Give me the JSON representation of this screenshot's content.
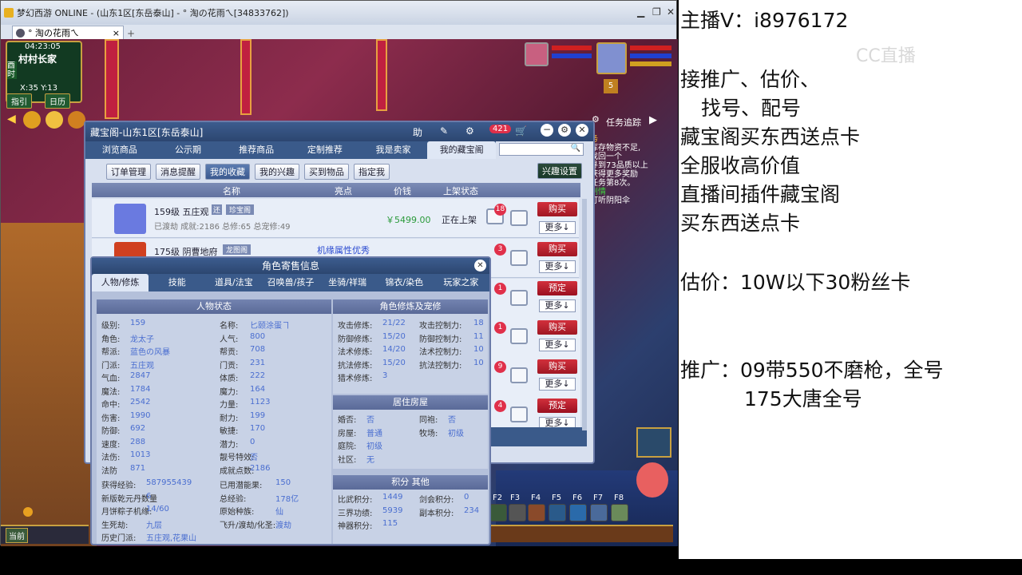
{
  "window": {
    "title": "梦幻西游 ONLINE - (山东1区[东岳泰山] - ° 淘の花雨ㄟ[34833762])",
    "tab_label": "° 淘の花雨ㄟ",
    "tab_close": "×",
    "tab_add": "+",
    "minimize": "▁",
    "restore": "❐",
    "close": "✕"
  },
  "hud": {
    "time": "04:23:05",
    "location": "村村长家",
    "day": "酉时",
    "coords": "X:35  Y:13",
    "guide": "指引",
    "calendar": "日历",
    "quest_tracker": "任务追踪",
    "chat_lines": [
      "务",
      "库存物资不足,",
      "找回一个",
      "寻到73品质以上",
      "获得更多奖励",
      "任务第8次。",
      "",
      "剧情",
      "打听阴阳伞"
    ],
    "level_badge": "5",
    "hotkeys": [
      "F2",
      "F3",
      "F4",
      "F5",
      "F6",
      "F7",
      "F8"
    ],
    "current": "当前"
  },
  "cbg": {
    "title": "藏宝阁-山东1区[东岳泰山]",
    "header_help": "助",
    "message_count": "421",
    "tabs": [
      "浏览商品",
      "公示期",
      "推荐商品",
      "定制推荐",
      "我是卖家",
      "我的藏宝阁"
    ],
    "active_tab": "我的藏宝阁",
    "sub_buttons": [
      "订单管理",
      "消息提醒",
      "我的收藏",
      "我的兴趣",
      "买到物品",
      "指定我"
    ],
    "active_sub": "我的收藏",
    "interest_setting": "兴趣设置",
    "columns": [
      "名称",
      "亮点",
      "价钱",
      "上架状态"
    ],
    "items": [
      {
        "title": "159级  五庄观",
        "tag1": "还",
        "tag2": "珍宝阁",
        "sub": "已渡劫 成就:2186 总修:65 总宠修:49",
        "highlight": "",
        "price": "￥5499.00",
        "status": "正在上架",
        "star_count": "18",
        "action": "购买",
        "more": "更多↓"
      },
      {
        "title": "175级  阴曹地府",
        "tag1": "",
        "tag2": "龙图阁",
        "sub": "",
        "highlight": "机缘属性优秀",
        "price": "",
        "status": "",
        "star_count": "3",
        "action": "购买",
        "more": "更多↓"
      },
      {
        "title": "",
        "tag1": "",
        "tag2": "",
        "sub": "",
        "highlight": "",
        "price": "",
        "status": "",
        "star_count": "1",
        "action": "预定",
        "more": "更多↓"
      },
      {
        "title": "",
        "tag1": "",
        "tag2": "",
        "sub": "",
        "highlight": "",
        "price": "",
        "status": "",
        "star_count": "1",
        "action": "购买",
        "more": "更多↓"
      },
      {
        "title": "",
        "tag1": "",
        "tag2": "",
        "sub": "",
        "highlight": "",
        "price": "",
        "status": "",
        "star_count": "9",
        "action": "购买",
        "more": "更多↓"
      },
      {
        "title": "",
        "tag1": "",
        "tag2": "",
        "sub": "",
        "highlight": "",
        "price": "",
        "status": "",
        "star_count": "4",
        "action": "预定",
        "more": "更多↓"
      }
    ]
  },
  "role": {
    "title": "角色寄售信息",
    "tabs": [
      "人物/修炼",
      "技能",
      "道具/法宝",
      "召唤兽/孩子",
      "坐骑/祥瑞",
      "锦衣/染色",
      "玩家之家"
    ],
    "active_tab": "人物/修炼",
    "status_header": "人物状态",
    "cultivation_header": "角色修炼及宠修",
    "house_header": "居住房屋",
    "score_header": "积分 其他",
    "left_stats": [
      [
        "级别:",
        "159"
      ],
      [
        "角色:",
        "龙太子"
      ],
      [
        "帮派:",
        "蓝色の风暴"
      ],
      [
        "门派:",
        "五庄观"
      ],
      [
        "气血:",
        "2847"
      ],
      [
        "魔法:",
        "1784"
      ],
      [
        "命中:",
        "2542"
      ],
      [
        "伤害:",
        "1990"
      ],
      [
        "防御:",
        "692"
      ],
      [
        "速度:",
        "288"
      ],
      [
        "法伤:",
        "1013"
      ],
      [
        "法防",
        "871"
      ]
    ],
    "mid_stats": [
      [
        "名称:",
        "匕颐涂蛋ヿ"
      ],
      [
        "人气:",
        "800"
      ],
      [
        "帮贡:",
        "708"
      ],
      [
        "门贡:",
        "231"
      ],
      [
        "体质:",
        "222"
      ],
      [
        "魔力:",
        "164"
      ],
      [
        "力量:",
        "1123"
      ],
      [
        "耐力:",
        "199"
      ],
      [
        "敏捷:",
        "170"
      ],
      [
        "潜力:",
        "0"
      ],
      [
        "靓号特效:",
        "否"
      ],
      [
        "成就点数:",
        "2186"
      ]
    ],
    "bottom_left": [
      [
        "获得经验:",
        "587955439"
      ],
      [
        "新版乾元丹数量",
        "6"
      ],
      [
        "月饼粽子机缘:",
        "14/60"
      ],
      [
        "生死劫:",
        "九层"
      ],
      [
        "历史门派:",
        "五庄观,花果山"
      ]
    ],
    "bottom_mid": [
      [
        "已用潜能果:",
        "150"
      ],
      [
        "总经验:",
        "178亿"
      ],
      [
        "原始种族:",
        "仙"
      ],
      [
        "飞升/渡劫/化圣:",
        "渡劫"
      ]
    ],
    "cultivation": [
      [
        "攻击修炼:",
        "21/22",
        "攻击控制力:",
        "18"
      ],
      [
        "防御修炼:",
        "15/20",
        "防御控制力:",
        "11"
      ],
      [
        "法术修炼:",
        "14/20",
        "法术控制力:",
        "10"
      ],
      [
        "抗法修炼:",
        "15/20",
        "抗法控制力:",
        "10"
      ],
      [
        "猎术修炼:",
        "3",
        "",
        ""
      ]
    ],
    "house": [
      [
        "婚否:",
        "否",
        "同袍:",
        "否"
      ],
      [
        "房屋:",
        "普通",
        "牧场:",
        "初级"
      ],
      [
        "庭院:",
        "初级",
        "",
        ""
      ],
      [
        "社区:",
        "无",
        "",
        ""
      ]
    ],
    "scores": [
      [
        "比武积分:",
        "1449",
        "剑会积分:",
        "0"
      ],
      [
        "三界功绩:",
        "5939",
        "副本积分:",
        "234"
      ],
      [
        "神器积分:",
        "115",
        "",
        ""
      ]
    ]
  },
  "overlay_text": {
    "line1": "主播V：i8976172",
    "line2": "接推广、估价、",
    "line3": "找号、配号",
    "line4": "藏宝阁买东西送点卡",
    "line5": "全服收高价值",
    "line6": "直播间插件藏宝阁",
    "line7": "买东西送点卡",
    "line8": "估价：10W以下30粉丝卡",
    "line9": "推广：09带550不磨枪，全号",
    "line10": "175大唐全号",
    "watermark": "CC直播"
  }
}
